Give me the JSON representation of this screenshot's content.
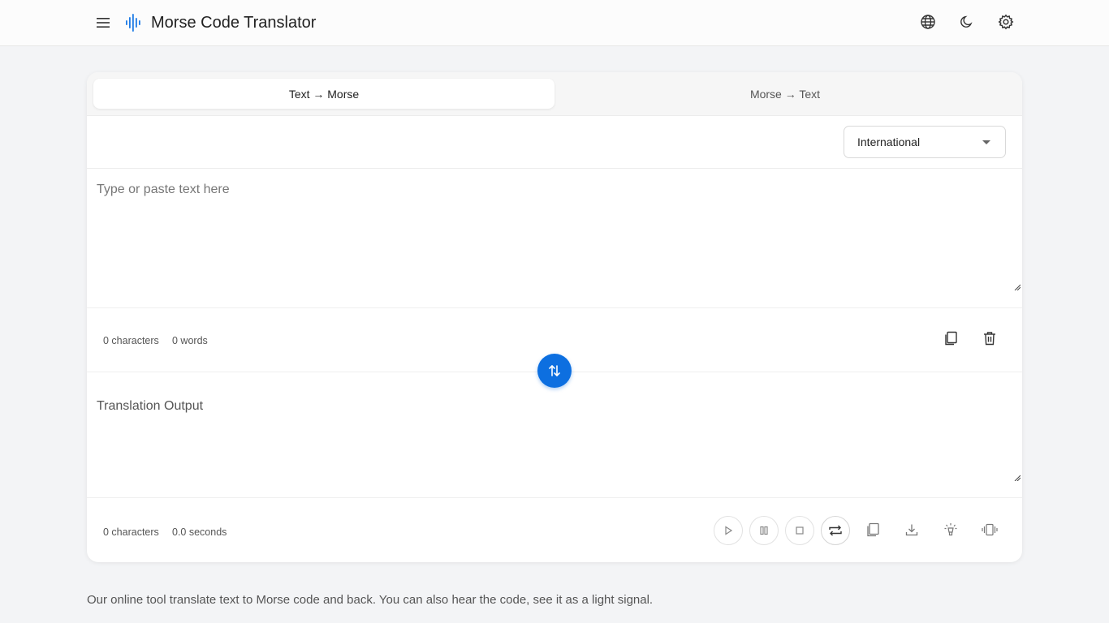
{
  "header": {
    "title": "Morse Code Translator",
    "icons": {
      "menu": "hamburger-icon",
      "logo": "sound-wave-icon",
      "language": "globe-icon",
      "theme": "moon-icon",
      "settings": "gear-icon"
    }
  },
  "tabs": [
    {
      "label": "Text → Morse",
      "active": true
    },
    {
      "label": "Morse → Text",
      "active": false
    }
  ],
  "standard_select": {
    "value": "International"
  },
  "input": {
    "placeholder": "Type or paste text here",
    "value": "",
    "char_count": "0 characters",
    "word_count": "0 words"
  },
  "output": {
    "label": "Translation Output",
    "char_count": "0 characters",
    "duration": "0.0 seconds"
  },
  "colors": {
    "accent": "#0d6fe0",
    "background": "#f3f4f6",
    "card": "#ffffff"
  },
  "footer": {
    "description": "Our online tool translate text to Morse code and back. You can also hear the code, see it as a light signal."
  }
}
